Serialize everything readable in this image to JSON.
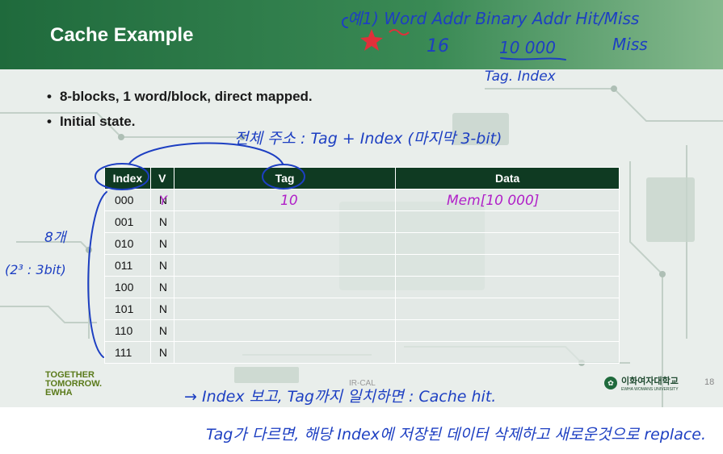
{
  "slide": {
    "title": "Cache Example",
    "bullets": [
      "8-blocks, 1 word/block, direct mapped.",
      "Initial state."
    ],
    "table": {
      "headers": [
        "Index",
        "V",
        "Tag",
        "Data"
      ],
      "rows": [
        {
          "index": "000",
          "v": "N",
          "tag": "",
          "data": ""
        },
        {
          "index": "001",
          "v": "N",
          "tag": "",
          "data": ""
        },
        {
          "index": "010",
          "v": "N",
          "tag": "",
          "data": ""
        },
        {
          "index": "011",
          "v": "N",
          "tag": "",
          "data": ""
        },
        {
          "index": "100",
          "v": "N",
          "tag": "",
          "data": ""
        },
        {
          "index": "101",
          "v": "N",
          "tag": "",
          "data": ""
        },
        {
          "index": "110",
          "v": "N",
          "tag": "",
          "data": ""
        },
        {
          "index": "111",
          "v": "N",
          "tag": "",
          "data": ""
        }
      ]
    },
    "footer": {
      "logo_lines": [
        "TOGETHER",
        "TOMORROW.",
        "EWHA"
      ],
      "center_text": "IR-CAL",
      "university_name": "이화여자대학교",
      "university_en": "EWHA WOMANS UNIVERSITY",
      "page_number": "18"
    }
  },
  "annotations": {
    "header_labels": "예1) Word Addr  Binary Addr  Hit/Miss",
    "word_addr": "16",
    "binary_addr": "10 000",
    "hit_miss": "Miss",
    "tag_index": "Tag. Index",
    "addr_note": "전체 주소 : Tag + Index (마지막 3-bit)",
    "valid_mark": "Y",
    "tag_value": "10",
    "data_value": "Mem[10 000]",
    "side_note_1": "8개",
    "side_note_2": "(2³ : 3bit)",
    "note_line_1": "→ Index 보고, Tag까지 일치하면 : Cache hit.",
    "note_line_2": "Tag가 다르면, 해당 Index에 저장된 데이터 삭제하고 새로운것으로 replace."
  },
  "colors": {
    "title_bar": "#1f6a3c",
    "table_header": "#0f3a22",
    "ink_blue": "#1d3fc2",
    "ink_purple": "#b020c8",
    "ink_red": "#e0303a"
  }
}
